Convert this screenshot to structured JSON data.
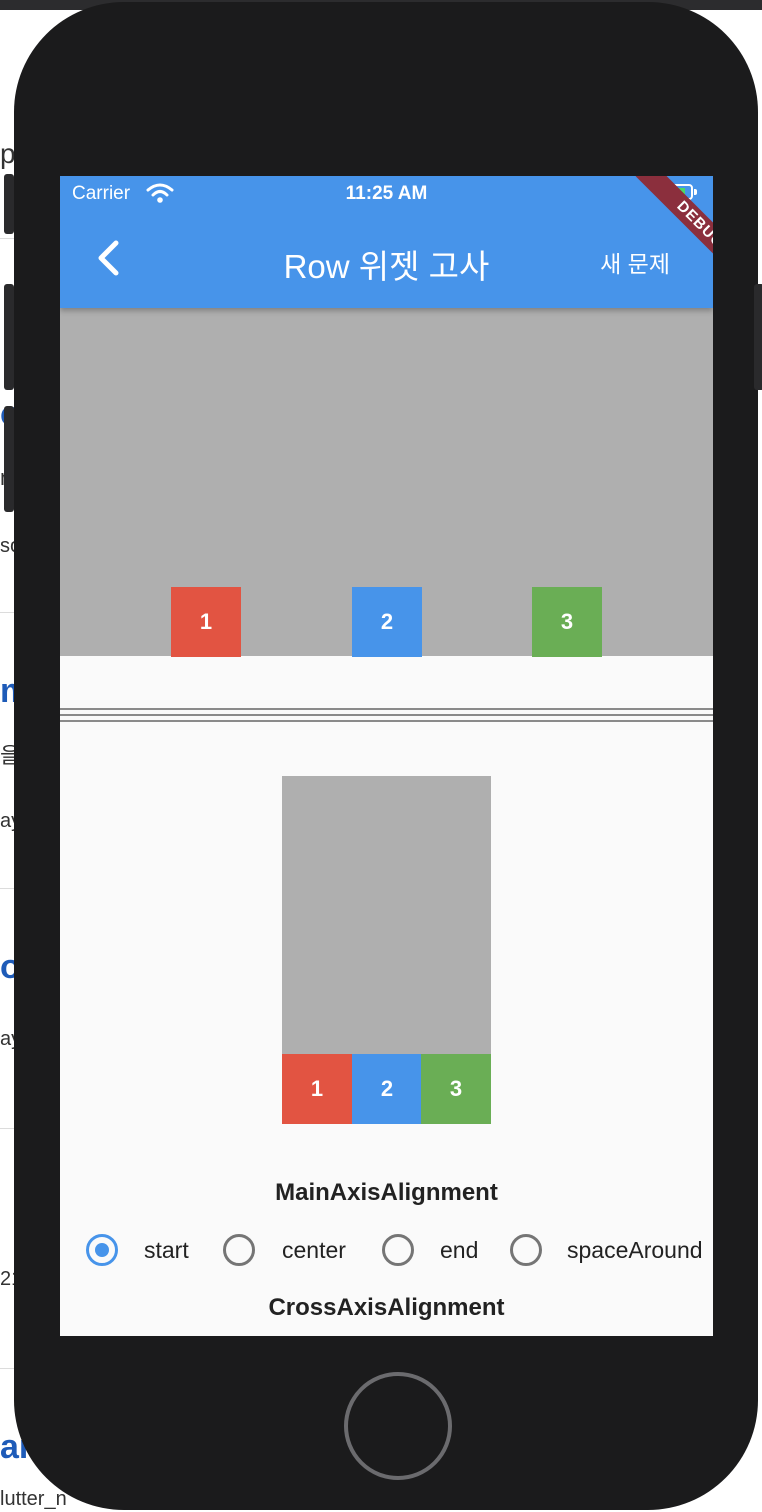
{
  "status_bar": {
    "carrier": "Carrier",
    "time": "11:25 AM"
  },
  "app_bar": {
    "title": "Row 위젯 고사",
    "action_label": "새 문제",
    "debug_banner": "DEBUG"
  },
  "preview": {
    "boxes": [
      "1",
      "2",
      "3"
    ]
  },
  "answer": {
    "boxes": [
      "1",
      "2",
      "3"
    ]
  },
  "main_axis": {
    "label": "MainAxisAlignment",
    "selected": "start",
    "options": [
      "start",
      "center",
      "end",
      "spaceAround"
    ]
  },
  "cross_axis": {
    "label": "CrossAxisAlignment"
  },
  "background": {
    "fragments": [
      "p",
      "o",
      "n",
      "so",
      "m",
      "을",
      "ay",
      "ol",
      "ay",
      "21",
      "ar",
      "lutter_n"
    ]
  },
  "colors": {
    "app_bar": "#4794ea",
    "box_red": "#e25442",
    "box_blue": "#4794ea",
    "box_green": "#6aae55",
    "preview_bg": "#afafaf"
  }
}
